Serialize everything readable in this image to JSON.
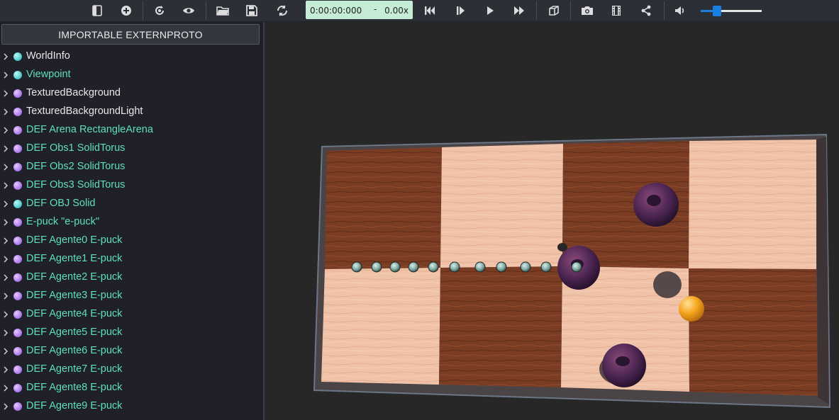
{
  "toolbar": {
    "buttons": [
      {
        "name": "toggle-scene-tree-icon",
        "interactable": true
      },
      {
        "name": "add-node-icon",
        "interactable": true
      },
      {
        "name": "reload-world-icon",
        "interactable": true
      },
      {
        "name": "view-eye-icon",
        "interactable": true
      },
      {
        "name": "open-folder-icon",
        "interactable": true
      },
      {
        "name": "save-icon",
        "interactable": true
      },
      {
        "name": "reset-simulation-icon",
        "interactable": true
      },
      {
        "name": "step-back-icon",
        "interactable": true
      },
      {
        "name": "step-icon",
        "interactable": true
      },
      {
        "name": "play-icon",
        "interactable": true
      },
      {
        "name": "fast-forward-icon",
        "interactable": true
      },
      {
        "name": "cube-view-icon",
        "interactable": true
      },
      {
        "name": "camera-screenshot-icon",
        "interactable": true
      },
      {
        "name": "film-record-icon",
        "interactable": true
      },
      {
        "name": "share-icon",
        "interactable": true
      },
      {
        "name": "volume-icon",
        "interactable": true
      }
    ],
    "time": "0:00:00:000",
    "time_separator": "-",
    "speed": "0.00x",
    "volume_level": 0.27
  },
  "scene_tree": {
    "proto_button": "IMPORTABLE EXTERNPROTO",
    "items": [
      {
        "label": "WorldInfo",
        "dot": "cyan",
        "label_color": "#e8e8e8"
      },
      {
        "label": "Viewpoint",
        "dot": "cyan",
        "label_color": "#5ee0b8"
      },
      {
        "label": "TexturedBackground",
        "dot": "purple",
        "label_color": "#e8e8e8"
      },
      {
        "label": "TexturedBackgroundLight",
        "dot": "purple",
        "label_color": "#e8e8e8"
      },
      {
        "label": "DEF Arena RectangleArena",
        "dot": "purple",
        "label_color": "#5ee0b8"
      },
      {
        "label": "DEF Obs1 SolidTorus",
        "dot": "purple",
        "label_color": "#5ee0b8"
      },
      {
        "label": "DEF Obs2 SolidTorus",
        "dot": "purple",
        "label_color": "#5ee0b8"
      },
      {
        "label": "DEF Obs3 SolidTorus",
        "dot": "purple",
        "label_color": "#5ee0b8"
      },
      {
        "label": "DEF OBJ Solid",
        "dot": "cyan",
        "label_color": "#5ee0b8"
      },
      {
        "label": "E-puck \"e-puck\"",
        "dot": "purple",
        "label_color": "#5ee0b8"
      },
      {
        "label": "DEF Agente0 E-puck",
        "dot": "purple",
        "label_color": "#5ee0b8"
      },
      {
        "label": "DEF Agente1 E-puck",
        "dot": "purple",
        "label_color": "#5ee0b8"
      },
      {
        "label": "DEF Agente2 E-puck",
        "dot": "purple",
        "label_color": "#5ee0b8"
      },
      {
        "label": "DEF Agente3 E-puck",
        "dot": "purple",
        "label_color": "#5ee0b8"
      },
      {
        "label": "DEF Agente4 E-puck",
        "dot": "purple",
        "label_color": "#5ee0b8"
      },
      {
        "label": "DEF Agente5 E-puck",
        "dot": "purple",
        "label_color": "#5ee0b8"
      },
      {
        "label": "DEF Agente6 E-puck",
        "dot": "purple",
        "label_color": "#5ee0b8"
      },
      {
        "label": "DEF Agente7 E-puck",
        "dot": "purple",
        "label_color": "#5ee0b8"
      },
      {
        "label": "DEF Agente8 E-puck",
        "dot": "purple",
        "label_color": "#5ee0b8"
      },
      {
        "label": "DEF Agente9 E-puck",
        "dot": "purple",
        "label_color": "#5ee0b8"
      }
    ]
  },
  "colors": {
    "light_wood": "#f0c2a8",
    "dark_wood": "#7a3d24",
    "torus": "#3a2040",
    "ball": "#f5a623",
    "epuck": "#8fb8b0"
  }
}
